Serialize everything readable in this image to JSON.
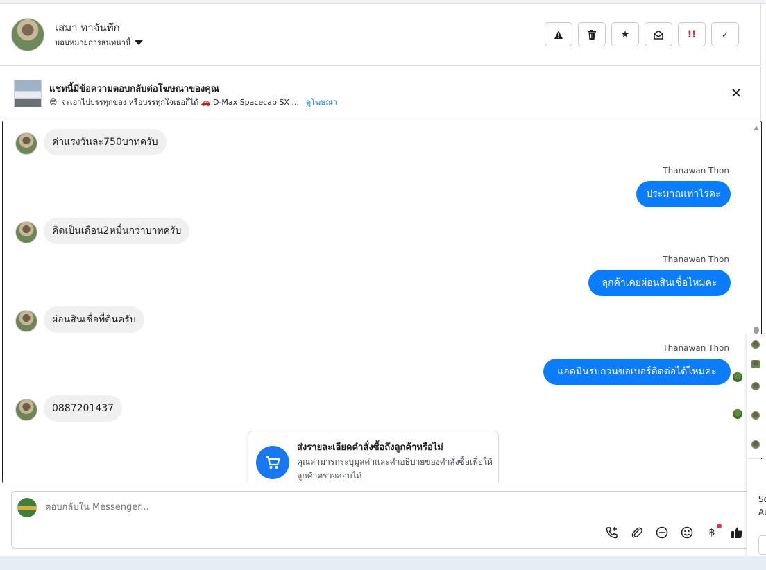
{
  "header": {
    "contact_name": "เสมา ทาจันทึก",
    "assign_label": "มอบหมายการสนทนานี้",
    "actions": [
      {
        "name": "spam",
        "symbol": "⚠"
      },
      {
        "name": "delete",
        "symbol": "🗑"
      },
      {
        "name": "star",
        "symbol": "★"
      },
      {
        "name": "mark-unread",
        "symbol": "✉"
      },
      {
        "name": "follow-up",
        "symbol": "‼"
      },
      {
        "name": "done",
        "symbol": "✓"
      }
    ]
  },
  "banner": {
    "title": "แชทนี้มีข้อความตอบกลับต่อโฆษณาของคุณ",
    "emoji": "😎",
    "subtitle": "จะเอาไปบรรทุกของ หรือบรรทุกใจเธอก็ได้ 🚗 D-Max Spacecab SX ...",
    "link": "ดูโฆษณา",
    "close_symbol": "✕"
  },
  "messages": [
    {
      "direction": "in",
      "text": "ค่าแรงวันละ750บาทครับ"
    },
    {
      "direction": "out",
      "sender": "Thanawan Thon",
      "text": "ประมาณเท่าไรคะ"
    },
    {
      "direction": "in",
      "text": "คิดเป็นเดือน2หมื่นกว่าบาทครับ"
    },
    {
      "direction": "out",
      "sender": "Thanawan Thon",
      "text": "ลุกค้าเคยผ่อนสินเชื่อไหมคะ"
    },
    {
      "direction": "in",
      "text": "ผ่อนสินเชื่อที่ดินครับ"
    },
    {
      "direction": "out",
      "sender": "Thanawan Thon",
      "text": "แอดมินรบกวนขอเบอร์ติดต่อได้ไหมคะ"
    },
    {
      "direction": "in",
      "text": "0887201437"
    }
  ],
  "order_card": {
    "title": "ส่งรายละเอียดคำสั่งซื้อถึงลูกค้าหรือไม่",
    "description": "คุณสามารถระบุมูลค่าและคำอธิบายของคำสั่งซื้อเพื่อให้ลูกค้าตรวจสอบได้"
  },
  "composer": {
    "placeholder": "ตอบกลับใน Messenger..."
  },
  "side_panel": {
    "text_1": "So",
    "text_2": "Au"
  },
  "colors": {
    "accent": "#0a7cff",
    "brand": "#1877f2",
    "incoming_bubble": "#f0f0f0",
    "badge_red": "#f02849"
  }
}
